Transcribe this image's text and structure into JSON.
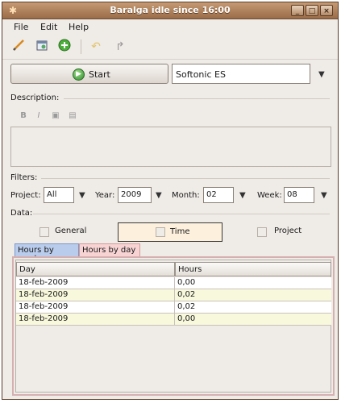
{
  "window": {
    "title": "Baralga idle since 16:00"
  },
  "menu": {
    "file": "File",
    "edit": "Edit",
    "help": "Help"
  },
  "toolbar": {
    "icons": [
      "edit-icon",
      "calendar-icon",
      "add-icon",
      "back-arrow-icon",
      "forward-arrow-icon"
    ]
  },
  "start_button": {
    "label": "Start"
  },
  "project_selector": {
    "value": "Softonic ES"
  },
  "description": {
    "label": "Description:"
  },
  "filters": {
    "label": "Filters:",
    "project_label": "Project:",
    "project_value": "All",
    "year_label": "Year:",
    "year_value": "2009",
    "month_label": "Month:",
    "month_value": "02",
    "week_label": "Week:",
    "week_value": "08"
  },
  "data_section": {
    "label": "Data:",
    "options": {
      "general": "General",
      "time": "Time",
      "project": "Project"
    },
    "selected": "Time"
  },
  "tabs": {
    "week": "Hours by week",
    "day": "Hours by day",
    "active": "Hours by day"
  },
  "table": {
    "headers": {
      "day": "Day",
      "hours": "Hours"
    },
    "rows": [
      {
        "day": "18-feb-2009",
        "hours": "0,00"
      },
      {
        "day": "18-feb-2009",
        "hours": "0,02"
      },
      {
        "day": "18-feb-2009",
        "hours": "0,02"
      },
      {
        "day": "18-feb-2009",
        "hours": "0,00"
      }
    ]
  }
}
